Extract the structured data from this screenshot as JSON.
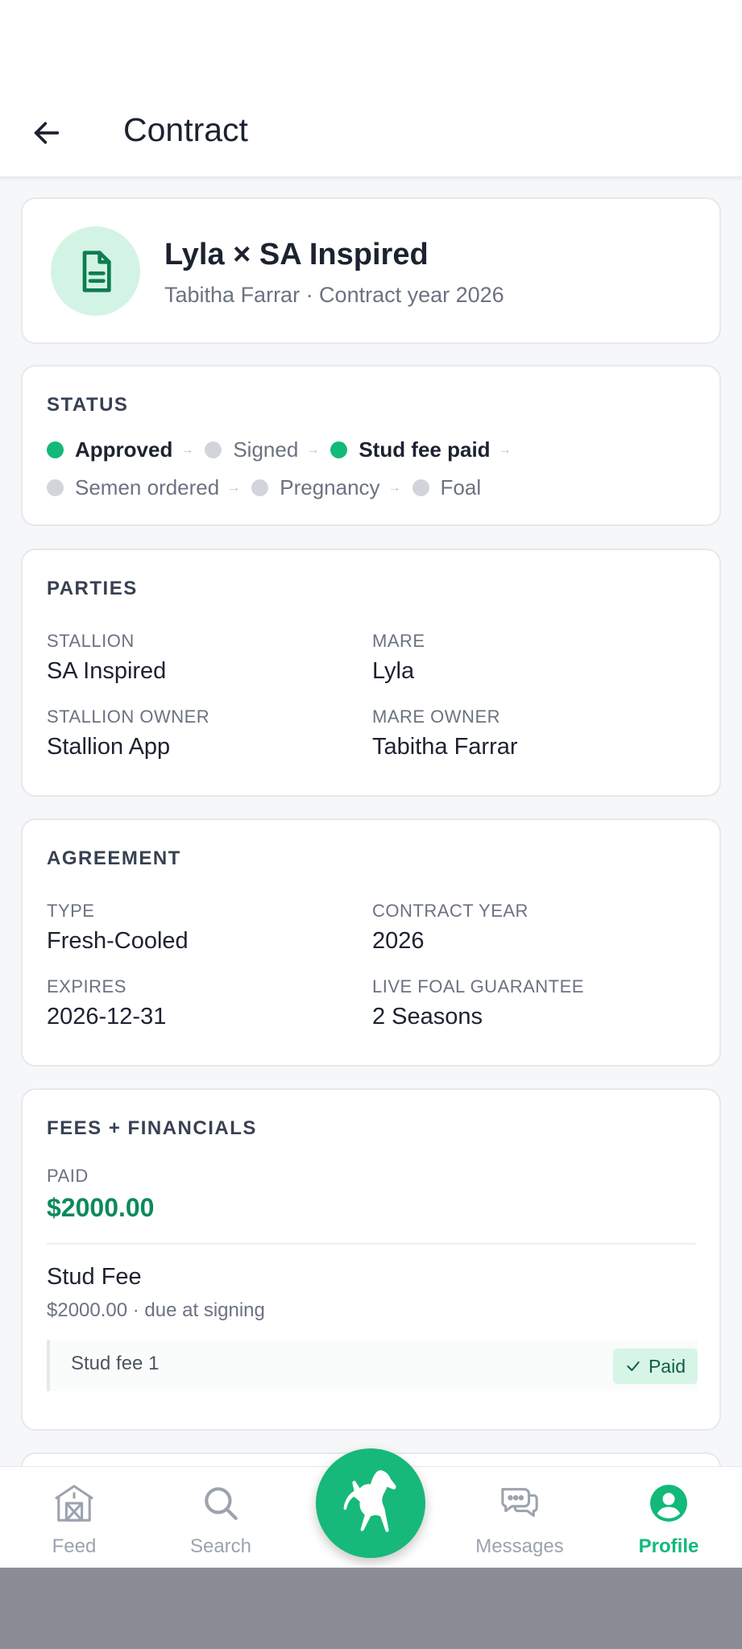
{
  "header": {
    "title": "Contract",
    "back_icon": "arrow-left-icon"
  },
  "hero": {
    "icon": "document-icon",
    "title": "Lyla × SA Inspired",
    "subtitle": "Tabitha Farrar · Contract year 2026"
  },
  "status": {
    "title": "STATUS",
    "steps": [
      {
        "label": "Approved",
        "done": true
      },
      {
        "label": "Signed",
        "done": false
      },
      {
        "label": "Stud fee paid",
        "done": true
      },
      {
        "label": "Semen ordered",
        "done": false
      },
      {
        "label": "Pregnancy",
        "done": false
      },
      {
        "label": "Foal",
        "done": false
      }
    ],
    "arrow": "→"
  },
  "parties": {
    "title": "PARTIES",
    "stallion_label": "STALLION",
    "stallion": "SA Inspired",
    "mare_label": "MARE",
    "mare": "Lyla",
    "stallion_owner_label": "STALLION OWNER",
    "stallion_owner": "Stallion App",
    "mare_owner_label": "MARE OWNER",
    "mare_owner": "Tabitha Farrar"
  },
  "agreement": {
    "title": "AGREEMENT",
    "type_label": "TYPE",
    "type": "Fresh-Cooled",
    "year_label": "CONTRACT YEAR",
    "year": "2026",
    "expires_label": "EXPIRES",
    "expires": "2026-12-31",
    "guarantee_label": "LIVE FOAL GUARANTEE",
    "guarantee": "2 Seasons"
  },
  "fees": {
    "title": "FEES + FINANCIALS",
    "paid_label": "PAID",
    "paid_amount": "$2000.00",
    "fee_name": "Stud Fee",
    "fee_detail": "$2000.00 · due at signing",
    "installment_name": "Stud fee 1",
    "badge": "Paid"
  },
  "nav": {
    "items": [
      {
        "label": "Feed",
        "icon": "barn-icon"
      },
      {
        "label": "Search",
        "icon": "search-icon"
      },
      {
        "label": "Messages",
        "icon": "chat-icon"
      },
      {
        "label": "Profile",
        "icon": "user-icon"
      }
    ],
    "active": "Profile",
    "fab_icon": "horse-icon"
  },
  "colors": {
    "accent": "#12b979",
    "accent_dark": "#0b8a5a",
    "badge_bg": "#d6f5e6"
  }
}
